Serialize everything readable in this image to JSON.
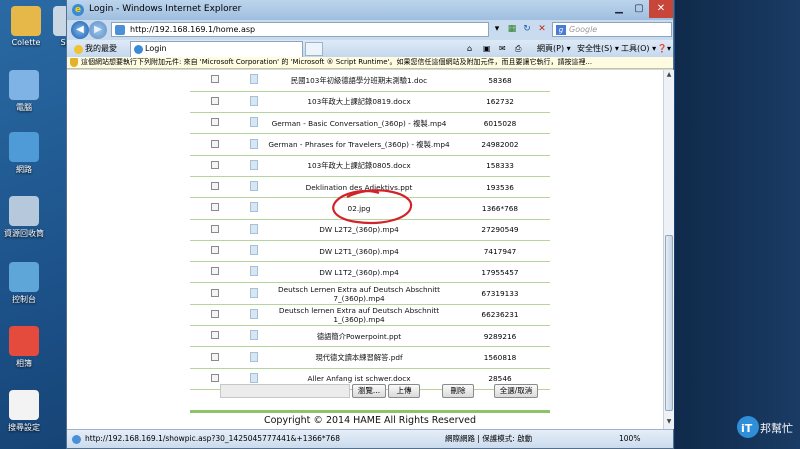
{
  "desktop": {
    "icons": [
      {
        "label": "Colette",
        "color": "#e6b84a"
      },
      {
        "label": "Spe",
        "color": "#c9d6e4"
      },
      {
        "label": "電腦",
        "color": "#7fb2e5"
      },
      {
        "label": "網路",
        "color": "#4f9bd8"
      },
      {
        "label": "資源回收筒",
        "color": "#b6c9dc"
      },
      {
        "label": "控制台",
        "color": "#5fa6d8"
      },
      {
        "label": "相簿",
        "color": "#e54b3c"
      },
      {
        "label": "搜尋設定",
        "color": "#f3f3f3"
      }
    ]
  },
  "window": {
    "title": "Login - Windows Internet Explorer",
    "address": "http://192.168.169.1/home.asp",
    "search_placeholder": "Google",
    "favorites_label": "我的最愛",
    "tab_title": "Login",
    "toolbar": {
      "page": "網頁(P) ▾",
      "safety": "安全性(S) ▾",
      "tools": "工具(O) ▾",
      "help": "❓▾"
    },
    "infobar": "這個網站想要執行下列附加元件: 來自 'Microsoft Corporation' 的 'Microsoft ® Script Runtime'。如果您信任這個網站及附加元件，而且要讓它執行，請按這裡..."
  },
  "files": [
    {
      "name": "民國103年初級德語學分班期末測驗1.doc",
      "size": "58368"
    },
    {
      "name": "103年政大上課記錄0819.docx",
      "size": "162732"
    },
    {
      "name": "German - Basic Conversation_(360p) - 複製.mp4",
      "size": "6015028"
    },
    {
      "name": "German - Phrases for Travelers_(360p) - 複製.mp4",
      "size": "24982002"
    },
    {
      "name": "103年政大上課記錄0805.docx",
      "size": "158333"
    },
    {
      "name": "Deklination des Adjektivs.ppt",
      "size": "193536"
    },
    {
      "name": "02.jpg",
      "size": "1366*768"
    },
    {
      "name": "DW L2T2_(360p).mp4",
      "size": "27290549"
    },
    {
      "name": "DW L2T1_(360p).mp4",
      "size": "7417947"
    },
    {
      "name": "DW L1T2_(360p).mp4",
      "size": "17955457"
    },
    {
      "name": "Deutsch Lernen Extra auf Deutsch Abschnitt 7_(360p).mp4",
      "size": "67319133"
    },
    {
      "name": "Deutsch lernen Extra auf Deutsch Abschnitt 1_(360p).mp4",
      "size": "66236231"
    },
    {
      "name": "德語簡介Powerpoint.ppt",
      "size": "9289216"
    },
    {
      "name": "現代德文讀本練習解答.pdf",
      "size": "1560818"
    },
    {
      "name": "Aller Anfang ist schwer.docx",
      "size": "28546"
    }
  ],
  "buttons": {
    "browse": "瀏覽...",
    "upload": "上傳",
    "delete": "刪除",
    "select_all": "全選/取消"
  },
  "footer": {
    "copyright": "Copyright © 2014 HAME All Rights Reserved"
  },
  "status": {
    "url": "http://192.168.169.1/showpic.asp?30_1425045777441&+1366*768",
    "zone": "網際網路 | 保護模式: 啟動",
    "zoom": "100%"
  },
  "watermark": "IT邦幫忙",
  "colors": {
    "accent_green": "#8ec26b",
    "annotation_red": "#d2232a"
  }
}
